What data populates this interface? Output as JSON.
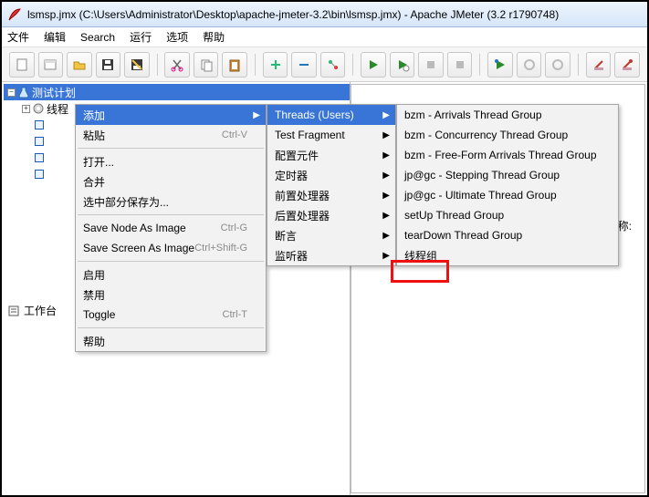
{
  "title": "lsmsp.jmx (C:\\Users\\Administrator\\Desktop\\apache-jmeter-3.2\\bin\\lsmsp.jmx) - Apache JMeter (3.2 r1790748)",
  "menubar": {
    "file": "文件",
    "edit": "编辑",
    "search": "Search",
    "run": "运行",
    "options": "选项",
    "help": "帮助"
  },
  "tree": {
    "root": "测试计划",
    "child": "线程",
    "workbench": "工作台"
  },
  "right": {
    "nameLabel": "名称:"
  },
  "ctx1": {
    "add": "添加",
    "paste": "粘贴",
    "paste_sc": "Ctrl-V",
    "open": "打开...",
    "merge": "合并",
    "saveSel": "选中部分保存为...",
    "saveNode": "Save Node As Image",
    "saveNode_sc": "Ctrl-G",
    "saveScreen": "Save Screen As Image",
    "saveScreen_sc": "Ctrl+Shift-G",
    "enable": "启用",
    "disable": "禁用",
    "toggle": "Toggle",
    "toggle_sc": "Ctrl-T",
    "helpItem": "帮助"
  },
  "ctx2": {
    "threads": "Threads (Users)",
    "testFragment": "Test Fragment",
    "config": "配置元件",
    "timer": "定时器",
    "pre": "前置处理器",
    "post": "后置处理器",
    "assert": "断言",
    "listener": "监听器"
  },
  "ctx3": {
    "i0": "bzm - Arrivals Thread Group",
    "i1": "bzm - Concurrency Thread Group",
    "i2": "bzm - Free-Form Arrivals Thread Group",
    "i3": "jp@gc - Stepping Thread Group",
    "i4": "jp@gc - Ultimate Thread Group",
    "i5": "setUp Thread Group",
    "i6": "tearDown Thread Group",
    "i7": "线程组"
  }
}
